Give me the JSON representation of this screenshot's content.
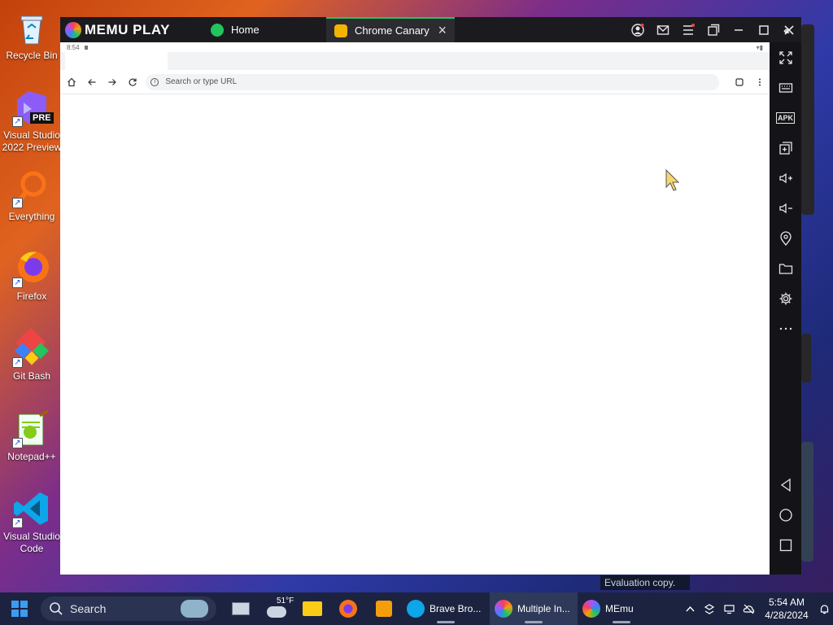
{
  "desktop": {
    "icons": [
      {
        "label": "Recycle Bin"
      },
      {
        "label": "Visual Studio 2022 Preview",
        "badge": "PRE"
      },
      {
        "label": "Everything"
      },
      {
        "label": "Firefox"
      },
      {
        "label": "Git Bash"
      },
      {
        "label": "Notepad++"
      },
      {
        "label": "Visual Studio Code"
      }
    ]
  },
  "memu": {
    "brand": "MEMU PLAY",
    "tabs": [
      {
        "label": "Home",
        "icon": "android-home-icon",
        "color": "#22c55e"
      },
      {
        "label": "Chrome Canary",
        "icon": "chrome-canary-icon",
        "color": "#f5b301",
        "close": "×"
      }
    ],
    "titlebar_buttons": [
      "account-icon",
      "mail-icon",
      "menu-icon",
      "restore-down-icon",
      "minimize-icon",
      "maximize-icon",
      "close-icon"
    ],
    "sidebar": {
      "collapse": "‹‹‹",
      "tools": [
        "fullscreen-icon",
        "keyboard-icon",
        "apk-icon",
        "multi-window-icon",
        "volume-up-icon",
        "volume-down-icon",
        "location-icon",
        "folder-icon",
        "settings-icon",
        "more-icon"
      ],
      "apk_label": "APK",
      "nav": [
        "back-icon",
        "home-icon",
        "recents-icon"
      ]
    }
  },
  "android": {
    "status_time": "8:54"
  },
  "chrome": {
    "address_placeholder": "Search or type URL"
  },
  "watermark": "Evaluation copy. Bu",
  "taskbar": {
    "search_label": "Search",
    "weather_temp": "51°F",
    "apps": [
      {
        "label": "Brave Bro...",
        "color": "#0ea5e9"
      },
      {
        "label": "Multiple In...",
        "color": "#f59e0b"
      },
      {
        "label": "MEmu",
        "color": "#a855f7"
      }
    ],
    "clock_time": "5:54 AM",
    "clock_date": "4/28/2024"
  }
}
